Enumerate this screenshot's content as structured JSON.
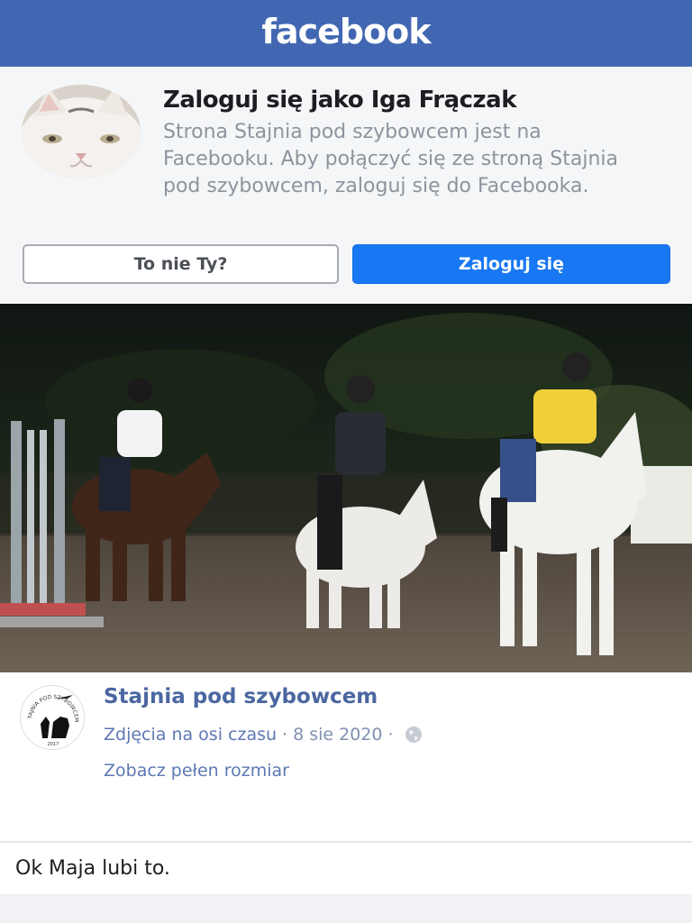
{
  "header": {
    "logo_text": "facebook",
    "brand_color": "#4267b2"
  },
  "login_prompt": {
    "title": "Zaloguj się jako Iga Frączak",
    "description": "Strona Stajnia pod szybowcem jest na Facebooku. Aby połączyć się ze stroną Stajnia pod szybowcem, zaloguj się do Facebooka.",
    "not_you_label": "To nie Ty?",
    "login_label": "Zaloguj się",
    "login_color": "#1877f2"
  },
  "post": {
    "page_name": "Stajnia pod szybowcem",
    "album_link": "Zdjęcia na osi czasu",
    "separator": "·",
    "date": "8 sie 2020",
    "privacy_icon": "globe-icon",
    "full_size_label": "Zobacz pełen rozmiar",
    "page_logo": {
      "arc_text": "STAJNIA POD SZYBOWCEM",
      "year": "2017"
    }
  },
  "likes": {
    "text": "Ok Maja lubi to."
  }
}
